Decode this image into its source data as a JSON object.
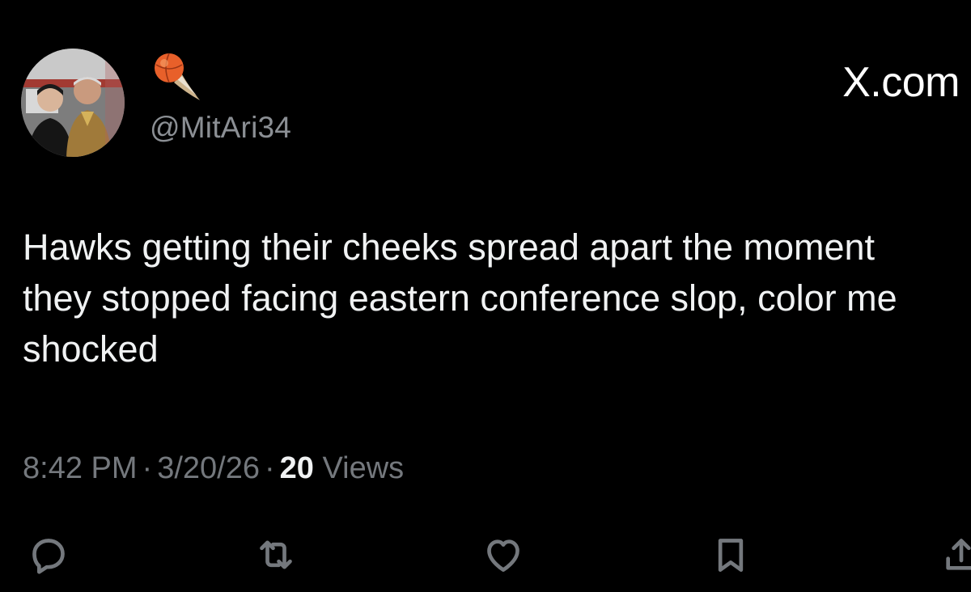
{
  "author": {
    "handle": "@MitAri34",
    "name_emoji": "comet-basketball-emoji",
    "avatar": "profile-photo-two-people"
  },
  "brand": "X.com",
  "tweet": {
    "text": "Hawks getting their cheeks spread apart the moment they stopped facing eastern conference slop, color me shocked"
  },
  "meta": {
    "time": "8:42 PM",
    "separator": "·",
    "date": "3/20/26",
    "views_count": "20",
    "views_label": "Views"
  },
  "actions": [
    {
      "icon": "reply-icon"
    },
    {
      "icon": "retweet-icon"
    },
    {
      "icon": "like-icon"
    },
    {
      "icon": "bookmark-icon"
    },
    {
      "icon": "share-icon"
    }
  ],
  "colors": {
    "background": "#000000",
    "text": "#f0f2f3",
    "secondary": "#74787d",
    "icon": "#74787d",
    "accent_emoji": "#e8602a"
  }
}
